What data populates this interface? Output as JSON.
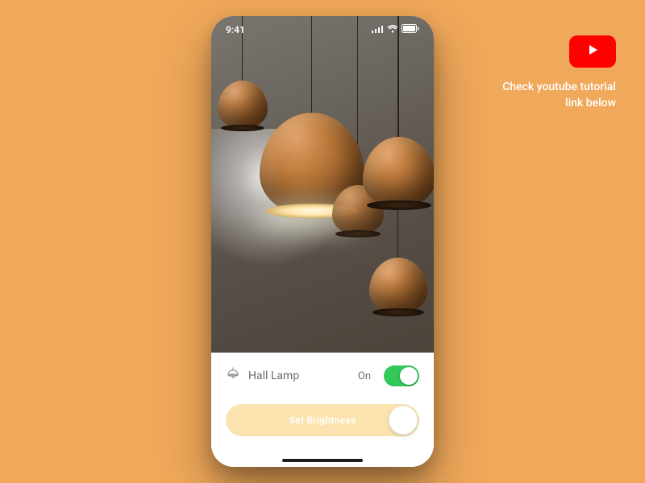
{
  "statusbar": {
    "time": "9:41"
  },
  "device": {
    "name": "Hall Lamp",
    "state_label": "On",
    "toggle_on": true
  },
  "slider": {
    "label": "Set Brightness"
  },
  "promo": {
    "line1": "Check youtube tutorial",
    "line2": "link below"
  },
  "colors": {
    "background": "#f0a85a",
    "toggle_on": "#34c759",
    "slider_fill": "#fbe3b0",
    "youtube": "#ff0000"
  }
}
